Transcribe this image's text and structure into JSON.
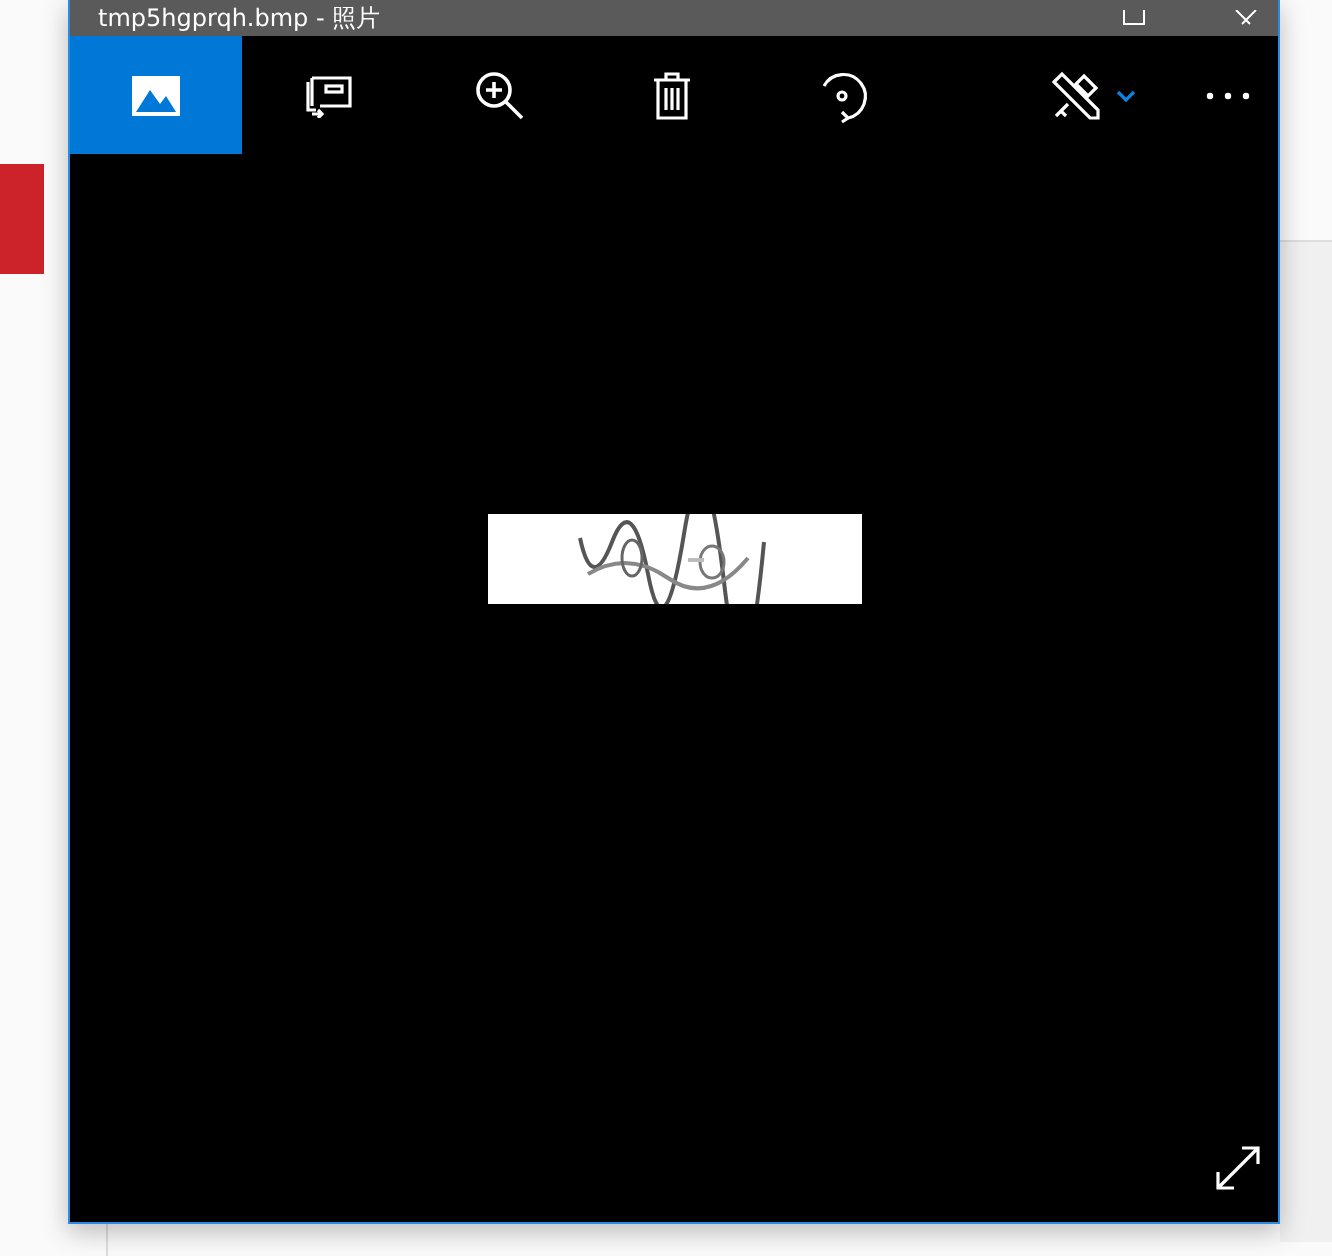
{
  "window": {
    "title": "tmp5hgprqh.bmp - 照片"
  },
  "toolbar": [
    {
      "kind": "collection",
      "selected": true
    },
    {
      "kind": "slideshow",
      "selected": false
    },
    {
      "kind": "zoom",
      "selected": false
    },
    {
      "kind": "delete",
      "selected": false
    },
    {
      "kind": "rotate",
      "selected": false
    },
    {
      "kind": "edit",
      "selected": false
    },
    {
      "kind": "more",
      "selected": false
    }
  ]
}
